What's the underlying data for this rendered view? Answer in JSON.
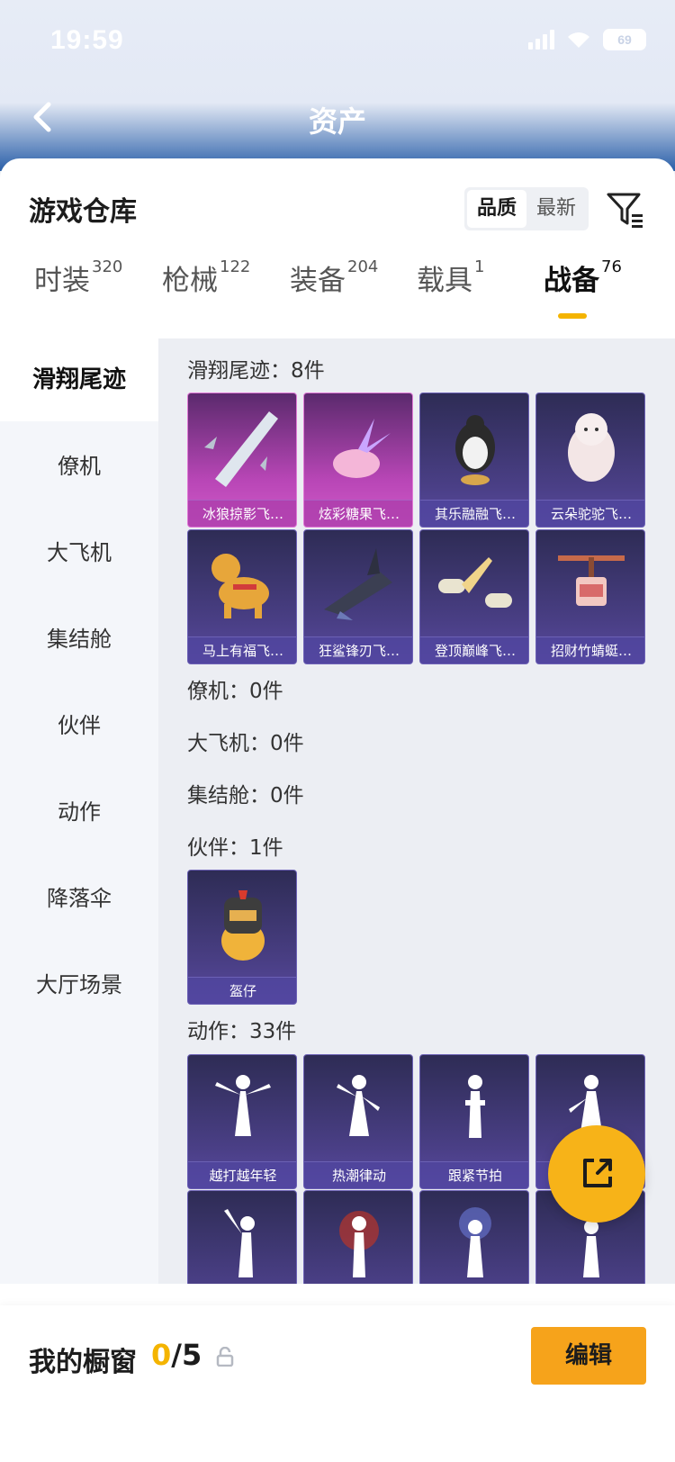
{
  "status": {
    "time": "19:59",
    "battery": "69"
  },
  "navbar": {
    "title": "资产"
  },
  "sheet": {
    "title": "游戏仓库"
  },
  "sort": {
    "options": [
      "品质",
      "最新"
    ],
    "active": "品质"
  },
  "tabs": [
    {
      "label": "时装",
      "count": "320"
    },
    {
      "label": "枪械",
      "count": "122"
    },
    {
      "label": "装备",
      "count": "204"
    },
    {
      "label": "载具",
      "count": "1"
    },
    {
      "label": "战备",
      "count": "76",
      "active": true
    }
  ],
  "categories": [
    "滑翔尾迹",
    "僚机",
    "大飞机",
    "集结舱",
    "伙伴",
    "动作",
    "降落伞",
    "大厅场景"
  ],
  "sections": {
    "glide": {
      "title": "滑翔尾迹：8件",
      "items": [
        "冰狼掠影飞…",
        "炫彩糖果飞…",
        "其乐融融飞…",
        "云朵驼驼飞…",
        "马上有福飞…",
        "狂鲨锋刃飞…",
        "登顶巅峰飞…",
        "招财竹蜻蜓…"
      ]
    },
    "wingman": {
      "title": "僚机：0件"
    },
    "plane": {
      "title": "大飞机：0件"
    },
    "pod": {
      "title": "集结舱：0件"
    },
    "partner": {
      "title": "伙伴：1件",
      "items": [
        "盔仔"
      ]
    },
    "emote": {
      "title": "动作：33件",
      "items": [
        "越打越年轻",
        "热潮律动",
        "跟紧节拍",
        ""
      ]
    }
  },
  "bottom": {
    "label": "我的橱窗",
    "current": "0",
    "total": "/5",
    "edit_label": "编辑"
  },
  "colors": {
    "accent": "#f4b400",
    "button": "#f6a31b",
    "card": "#4a3f86",
    "card_highlight": "#b846b6"
  }
}
